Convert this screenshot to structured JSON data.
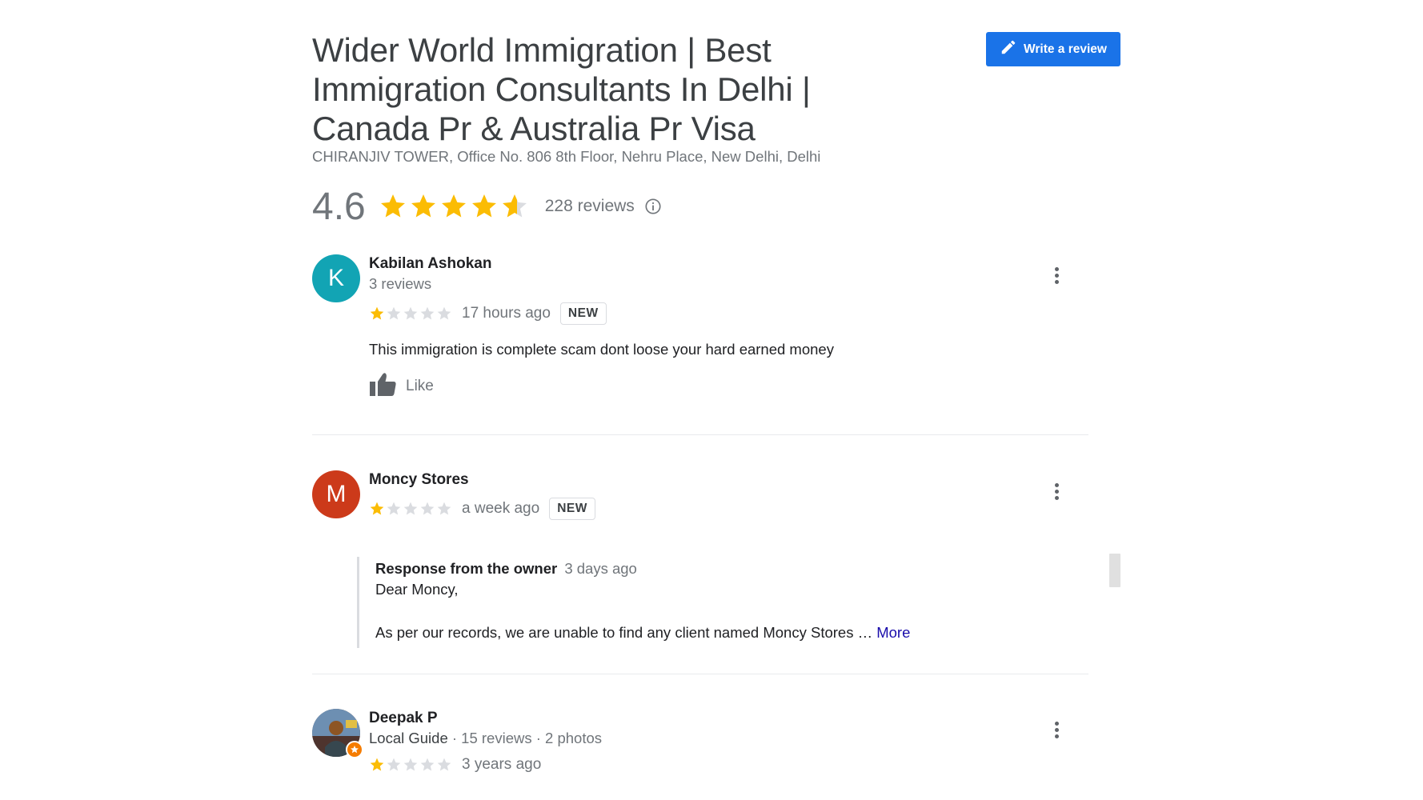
{
  "business": {
    "name": "Wider World Immigration | Best Immigration Consultants In Delhi | Canada Pr & Australia Pr Visa",
    "address": "CHIRANJIV TOWER, Office No. 806 8th Floor, Nehru Place, New Delhi, Delhi",
    "rating": "4.6",
    "rating_value": 4.6,
    "reviews_count": "228 reviews",
    "write_review_label": "Write a review"
  },
  "colors": {
    "accent": "#1a73e8",
    "star_filled": "#fbbc04",
    "star_empty": "#dadce0",
    "link": "#1a0dab"
  },
  "icons": {
    "write": "pencil-icon",
    "info": "info-icon",
    "like": "thumbs-up-icon",
    "menu": "more-vert-icon",
    "local_guide": "local-guide-badge-icon"
  },
  "reviews": [
    {
      "avatar_letter": "K",
      "avatar_color": "#12a4b4",
      "author": "Kabilan Ashokan",
      "meta": "3 reviews",
      "stars": 1,
      "time": "17 hours ago",
      "badge": "NEW",
      "text": "This immigration is complete scam dont loose your hard earned money",
      "like_label": "Like"
    },
    {
      "avatar_letter": "M",
      "avatar_color": "#cc3a1a",
      "author": "Moncy Stores",
      "stars": 1,
      "time": "a week ago",
      "badge": "NEW",
      "owner_response": {
        "label": "Response from the owner",
        "time": "3 days ago",
        "line1": "Dear Moncy,",
        "line2": "As per our records, we are unable to find any client named Moncy Stores …",
        "more": "More"
      }
    },
    {
      "author": "Deepak P",
      "meta_guide": "Local Guide",
      "meta_rest": " · 15 reviews · 2 photos",
      "stars": 1,
      "time": "3 years ago"
    }
  ]
}
